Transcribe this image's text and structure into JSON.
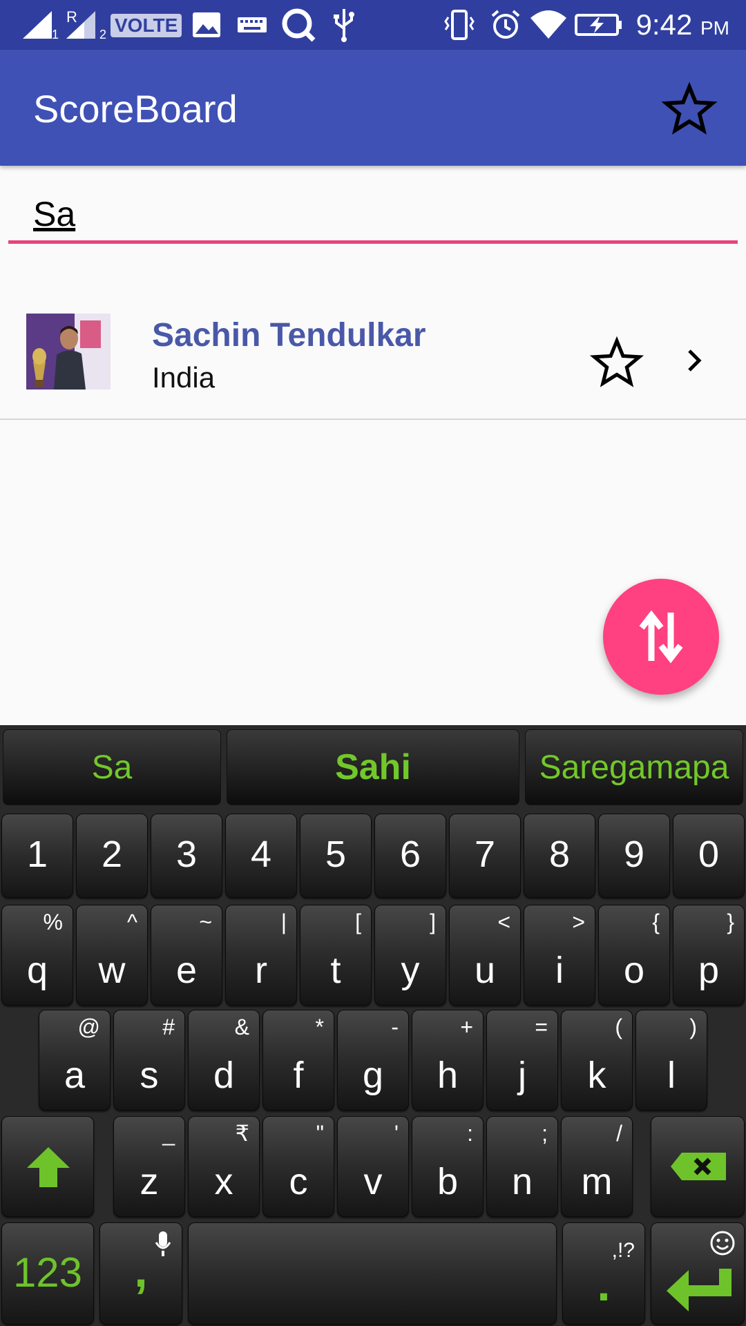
{
  "status_bar": {
    "volte": "VOLTE",
    "time": "9:42",
    "ampm": "PM",
    "sim1": "1",
    "sim2": "2",
    "roaming": "R"
  },
  "app_bar": {
    "title": "ScoreBoard"
  },
  "search": {
    "value": "Sa"
  },
  "results": [
    {
      "name": "Sachin Tendulkar",
      "country": "India"
    }
  ],
  "colors": {
    "primary": "#3f51b5",
    "primary_dark": "#303f9f",
    "accent": "#ff4081",
    "keyboard_green": "#6ec32b"
  },
  "keyboard": {
    "suggestions": [
      "Sa",
      "Sahi",
      "Saregamapa"
    ],
    "row_numbers": [
      "1",
      "2",
      "3",
      "4",
      "5",
      "6",
      "7",
      "8",
      "9",
      "0"
    ],
    "row1": [
      {
        "k": "q",
        "a": "%"
      },
      {
        "k": "w",
        "a": "^"
      },
      {
        "k": "e",
        "a": "~"
      },
      {
        "k": "r",
        "a": "|"
      },
      {
        "k": "t",
        "a": "["
      },
      {
        "k": "y",
        "a": "]"
      },
      {
        "k": "u",
        "a": "<"
      },
      {
        "k": "i",
        "a": ">"
      },
      {
        "k": "o",
        "a": "{"
      },
      {
        "k": "p",
        "a": "}"
      }
    ],
    "row2": [
      {
        "k": "a",
        "a": "@"
      },
      {
        "k": "s",
        "a": "#"
      },
      {
        "k": "d",
        "a": "&"
      },
      {
        "k": "f",
        "a": "*"
      },
      {
        "k": "g",
        "a": "-"
      },
      {
        "k": "h",
        "a": "+"
      },
      {
        "k": "j",
        "a": "="
      },
      {
        "k": "k",
        "a": "("
      },
      {
        "k": "l",
        "a": ")"
      }
    ],
    "row3": [
      {
        "k": "z",
        "a": "_"
      },
      {
        "k": "x",
        "a": "₹"
      },
      {
        "k": "c",
        "a": "\""
      },
      {
        "k": "v",
        "a": "'"
      },
      {
        "k": "b",
        "a": ":"
      },
      {
        "k": "n",
        "a": ";"
      },
      {
        "k": "m",
        "a": "/"
      }
    ],
    "symbols_key": "123",
    "comma_key": ",",
    "period_key": ".",
    "period_alt": ",!?"
  }
}
